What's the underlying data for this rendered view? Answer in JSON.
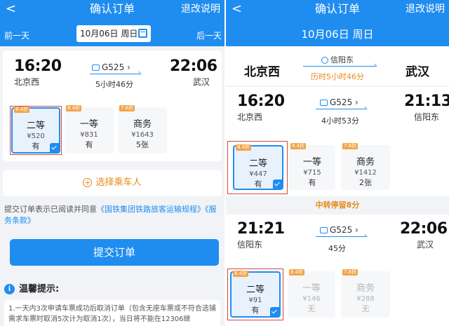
{
  "left": {
    "nav": {
      "back": "<",
      "title": "确认订单",
      "rules": "退改说明"
    },
    "date_bar": {
      "prev": "前一天",
      "date": "10月06日 周日",
      "next": "后一天"
    },
    "train": {
      "depart_time": "16:20",
      "depart_station": "北京西",
      "train_no": "G525 ›",
      "duration": "5小时46分",
      "arrive_time": "22:06",
      "arrive_station": "武汉"
    },
    "seats": [
      {
        "discount": "8.4折",
        "name": "二等",
        "price": "¥520",
        "avail": "有"
      },
      {
        "discount": "8.4折",
        "name": "一等",
        "price": "¥831",
        "avail": "有"
      },
      {
        "discount": "7.6折",
        "name": "商务",
        "price": "¥1643",
        "avail": "5张"
      }
    ],
    "passenger_button": "选择乘车人",
    "notice": {
      "prefix": "提交订单表示已阅读并同意",
      "link1": "《国铁集团铁路旅客运输规程》",
      "link2": "《服务条款》"
    },
    "submit": "提交订单",
    "tips_title": "温馨提示:",
    "tips_text": "1.一天内3次申请车票成功后取消订单（包含无座车票或不符合选铺需求车票时取消5次计为取消1次），当日将不能在12306继"
  },
  "right": {
    "nav": {
      "back": "<",
      "title": "确认订单",
      "rules": "退改说明"
    },
    "date": "10月06日 周日",
    "route": {
      "from": "北京西",
      "transfer": "信阳东",
      "total": "历时5小时46分",
      "to": "武汉"
    },
    "seg1": {
      "depart_time": "16:20",
      "depart_station": "北京西",
      "train_no": "G525 ›",
      "duration": "4小时53分",
      "arrive_time": "21:13",
      "arrive_station": "信阳东",
      "seats": [
        {
          "discount": "8.4折",
          "name": "二等",
          "price": "¥447",
          "avail": "有"
        },
        {
          "discount": "8.4折",
          "name": "一等",
          "price": "¥715",
          "avail": "有"
        },
        {
          "discount": "7.6折",
          "name": "商务",
          "price": "¥1412",
          "avail": "2张"
        }
      ]
    },
    "transfer_stop": "中转停留8分",
    "seg2": {
      "depart_time": "21:21",
      "depart_station": "信阳东",
      "train_no": "G525 ›",
      "duration": "45分",
      "arrive_time": "22:06",
      "arrive_station": "武汉",
      "seats": [
        {
          "discount": "8.4折",
          "name": "二等",
          "price": "¥91",
          "avail": "有"
        },
        {
          "discount": "8.4折",
          "name": "一等",
          "price": "¥146",
          "avail": "无"
        },
        {
          "discount": "7.6折",
          "name": "商务",
          "price": "¥288",
          "avail": "无"
        }
      ]
    }
  },
  "colors": {
    "primary": "#1f8df0",
    "accent": "#e88a1a",
    "badge": "#f2a44a",
    "highlight": "#d9453d"
  }
}
